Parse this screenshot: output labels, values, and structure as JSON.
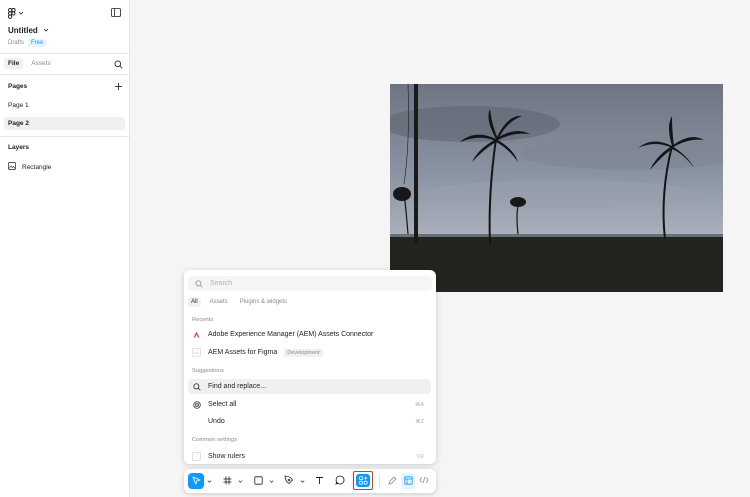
{
  "sidebar": {
    "file_title": "Untitled",
    "location": "Drafts",
    "plan_badge": "Free",
    "tabs": [
      {
        "label": "File"
      },
      {
        "label": "Assets"
      }
    ],
    "pages_title": "Pages",
    "pages": [
      {
        "label": "Page 1"
      },
      {
        "label": "Page 2"
      }
    ],
    "layers_title": "Layers",
    "layers": [
      {
        "label": "Rectangle"
      }
    ]
  },
  "actions_menu": {
    "search_placeholder": "Search",
    "tabs": [
      {
        "label": "All"
      },
      {
        "label": "Assets"
      },
      {
        "label": "Plugins & widgets"
      }
    ],
    "recents_title": "Recents",
    "recents": [
      {
        "label": "Adobe Experience Manager (AEM) Assets Connector",
        "icon": "adobe-icon"
      },
      {
        "label": "AEM Assets for Figma",
        "tag": "Development",
        "icon": "code-icon"
      }
    ],
    "suggestions_title": "Suggestions",
    "suggestions": [
      {
        "label": "Find and replace...",
        "icon": "search-icon"
      },
      {
        "label": "Select all",
        "shortcut": "⌘A",
        "icon": "target-icon"
      },
      {
        "label": "Undo",
        "shortcut": "⌘Z"
      }
    ],
    "common_title": "Common settings",
    "common": [
      {
        "label": "Show rulers",
        "shortcut": "⇧R"
      }
    ]
  },
  "colors": {
    "accent": "#0d99ff",
    "highlight_border": "#e03131"
  }
}
